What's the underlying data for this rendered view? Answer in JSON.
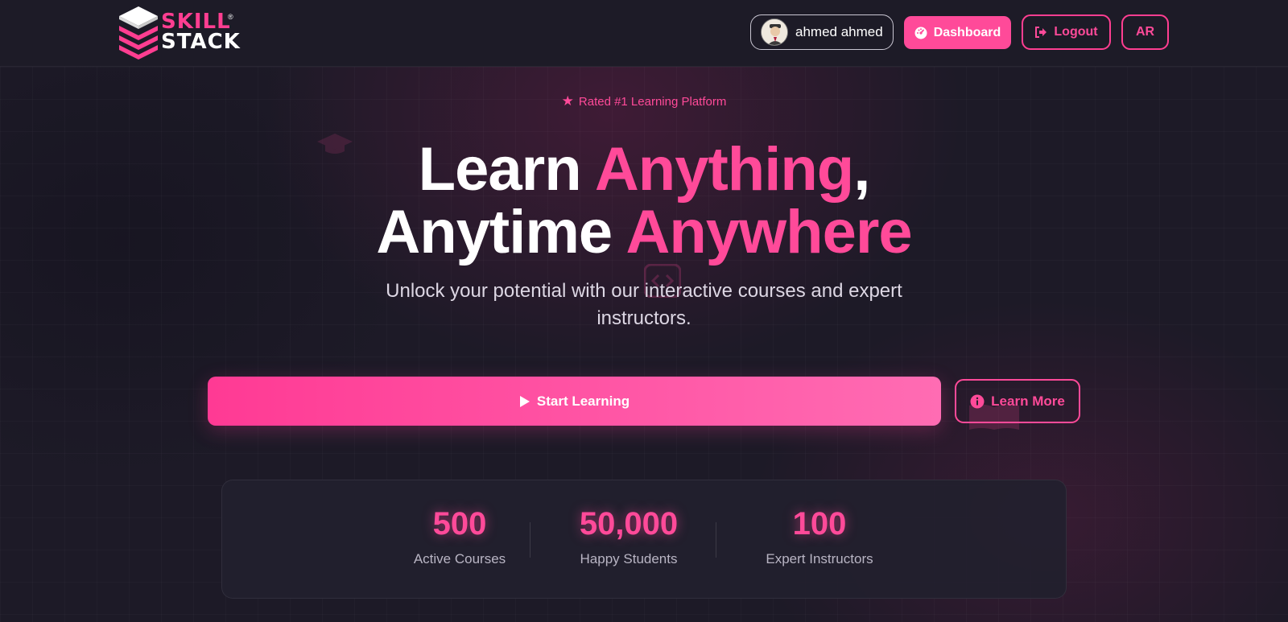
{
  "brand": {
    "line1": "SKILL",
    "line2": "STACK",
    "reg": "®",
    "pink": "#ff3e91"
  },
  "header": {
    "user_name": "ahmed ahmed",
    "dashboard_label": "Dashboard",
    "logout_label": "Logout",
    "lang_label": "AR"
  },
  "hero": {
    "badge": "Rated #1 Learning Platform",
    "title_part1": "Learn ",
    "title_part2": "Anything",
    "title_part3": ",",
    "title_part4": "Anytime ",
    "title_part5": "Anywhere",
    "subtitle": "Unlock your potential with our interactive courses and expert instructors.",
    "start_label": "Start Learning",
    "learn_more_label": "Learn More"
  },
  "stats": [
    {
      "value": "500",
      "label": "Active Courses"
    },
    {
      "value": "50,000",
      "label": "Happy Students"
    },
    {
      "value": "100",
      "label": "Expert Instructors"
    }
  ]
}
